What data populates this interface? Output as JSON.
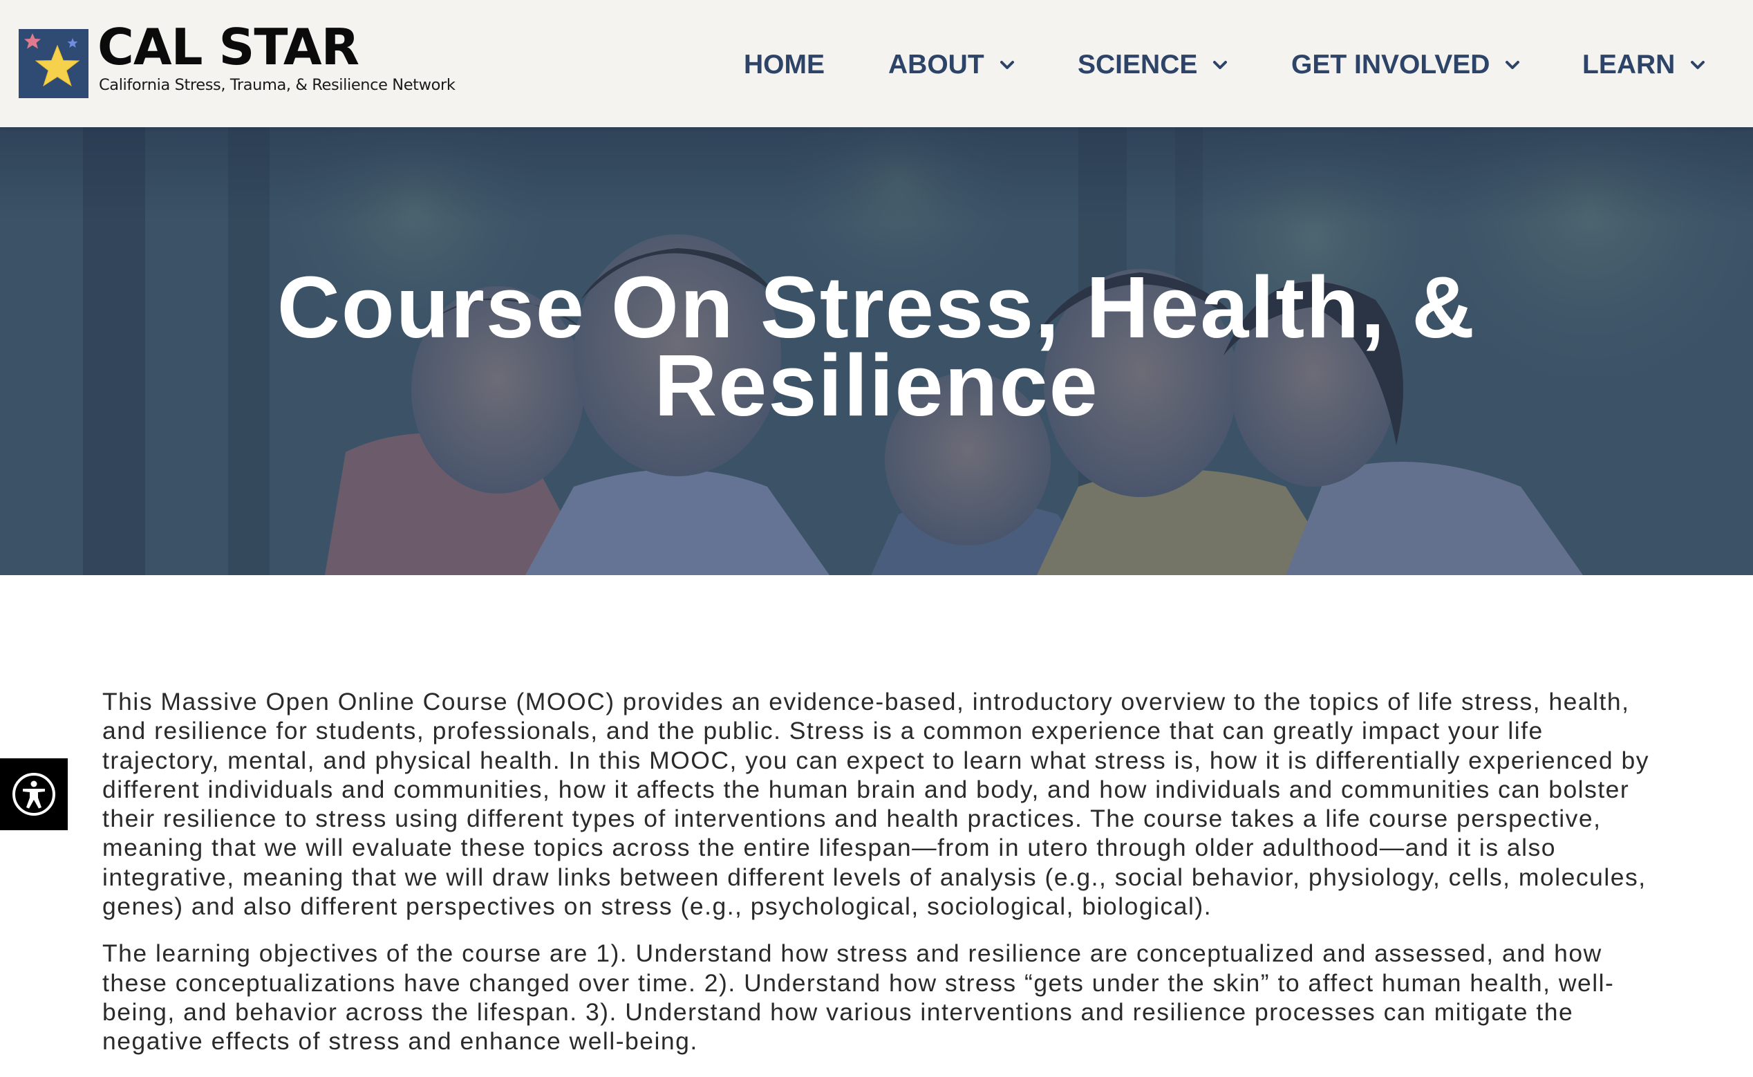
{
  "header": {
    "logo": {
      "title": "CAL STAR",
      "subtitle": "California Stress, Trauma, & Resilience Network",
      "colors": {
        "square": "#2f4a73",
        "big_star": "#f6d14b",
        "small_star_pink": "#e07a8d",
        "small_star_blue": "#6f8ee0"
      }
    },
    "nav": [
      {
        "label": "HOME",
        "has_dropdown": false
      },
      {
        "label": "ABOUT",
        "has_dropdown": true
      },
      {
        "label": "SCIENCE",
        "has_dropdown": true
      },
      {
        "label": "GET INVOLVED",
        "has_dropdown": true
      },
      {
        "label": "LEARN",
        "has_dropdown": true
      }
    ],
    "nav_color": "#2d4468",
    "background": "#f4f3ef"
  },
  "hero": {
    "title": "Course On Stress, Health, & Resilience",
    "overlay_color": "#2e4261",
    "photo_description_icon": "family-photo"
  },
  "content": {
    "paragraphs": [
      "This Massive Open Online Course (MOOC) provides an evidence-based, introductory overview to the topics of life stress, health, and resilience for students, professionals, and the public. Stress is a common experience that can greatly impact your life trajectory, mental, and physical health. In this MOOC, you can expect to learn what stress is, how it is differentially experienced by different individuals and communities, how it affects the human brain and body, and how individuals and communities can bolster their resilience to stress using different types of interventions and health practices. The course takes a life course perspective, meaning that we will evaluate these topics across the entire lifespan—from in utero through older adulthood—and it is also integrative, meaning that we will draw links between different levels of analysis (e.g., social behavior, physiology, cells, molecules, genes) and also different perspectives on stress (e.g., psychological, sociological, biological).",
      "The learning objectives of the course are 1). Understand how stress and resilience are conceptualized and assessed, and how these conceptualizations have changed over time. 2). Understand how stress “gets under the skin” to affect human health, well-being, and behavior across the lifespan. 3). Understand how various interventions and resilience processes can mitigate the negative effects of stress and enhance well-being."
    ]
  },
  "accessibility_widget": {
    "icon": "accessibility-icon",
    "background": "#000000"
  }
}
